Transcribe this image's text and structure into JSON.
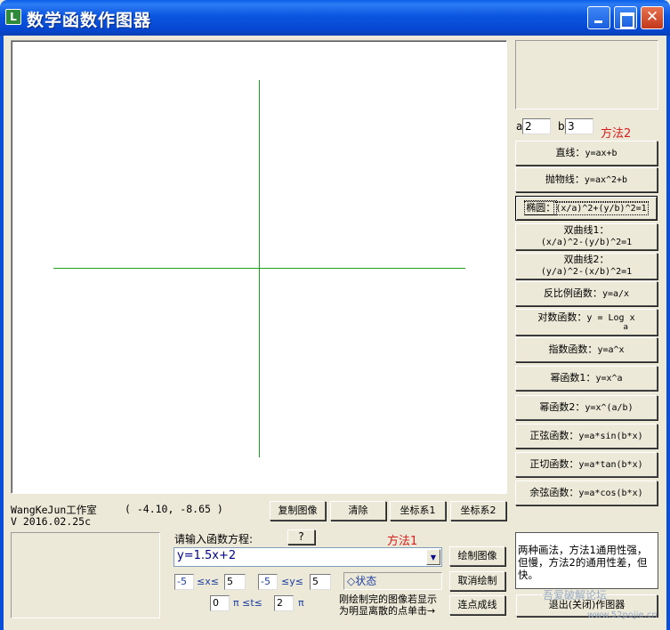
{
  "window": {
    "title": "数学函数作图器",
    "icon_letter": "L"
  },
  "canvas": {
    "axis_color": "#1aa51a"
  },
  "footer": {
    "studio": "WangKeJun工作室",
    "version": "V 2016.02.25c",
    "coords": "( -4.10, -8.65 )"
  },
  "toolbar": {
    "copy_image": "复制图像",
    "clear": "清除",
    "coord1": "坐标系1",
    "coord2": "坐标系2"
  },
  "input": {
    "prompt": "请输入函数方程:",
    "help_button": "?",
    "method1": "方法1",
    "equation": "y=1.5x+2",
    "draw_button": "绘制图像",
    "cancel_button": "取消绘制",
    "connect_button": "连点成线",
    "x_min": "-5",
    "x_max": "5",
    "y_min": "-5",
    "y_max": "5",
    "x_range_sym": "≤x≤",
    "y_range_sym": "≤y≤",
    "t_min": "0",
    "t_max": "2",
    "t_range_sym": "π ≤t≤",
    "t_unit": "π",
    "status": "◇状态",
    "hint_line1": "刚绘制完的图像若显示",
    "hint_line2": "为明显离散的点单击→"
  },
  "params": {
    "a_label": "a",
    "a_value": "2",
    "b_label": "b",
    "b_value": "3",
    "method2": "方法2"
  },
  "functions": [
    {
      "label": "直线：",
      "formula": "y=ax+b"
    },
    {
      "label": "抛物线：",
      "formula": "y=ax^2+b"
    },
    {
      "label": "椭圆：",
      "formula": "(x/a)^2+(y/b)^2=1"
    },
    {
      "label": "双曲线1：",
      "formula": "(x/a)^2-(y/b)^2=1"
    },
    {
      "label": "双曲线2：",
      "formula": "(y/a)^2-(x/b)^2=1"
    },
    {
      "label": "反比例函数：",
      "formula": "y=a/x"
    },
    {
      "label": "对数函数：",
      "formula": "y = Log  x",
      "sub": "a"
    },
    {
      "label": "指数函数：",
      "formula": "y=a^x"
    },
    {
      "label": "幂函数1：",
      "formula": "y=x^a"
    },
    {
      "label": "幂函数2：",
      "formula": "y=x^(a/b)"
    },
    {
      "label": "正弦函数：",
      "formula": "y=a*sin(b*x)"
    },
    {
      "label": "正切函数：",
      "formula": "y=a*tan(b*x)"
    },
    {
      "label": "余弦函数：",
      "formula": "y=a*cos(b*x)"
    }
  ],
  "info": {
    "text": "两种画法，方法1通用性强，但慢，方法2的通用性差，但快。"
  },
  "exit_button": "退出(关闭)作图器",
  "watermark": {
    "line1": "吾爱破解论坛",
    "line2": "www.52pojie.cn"
  }
}
